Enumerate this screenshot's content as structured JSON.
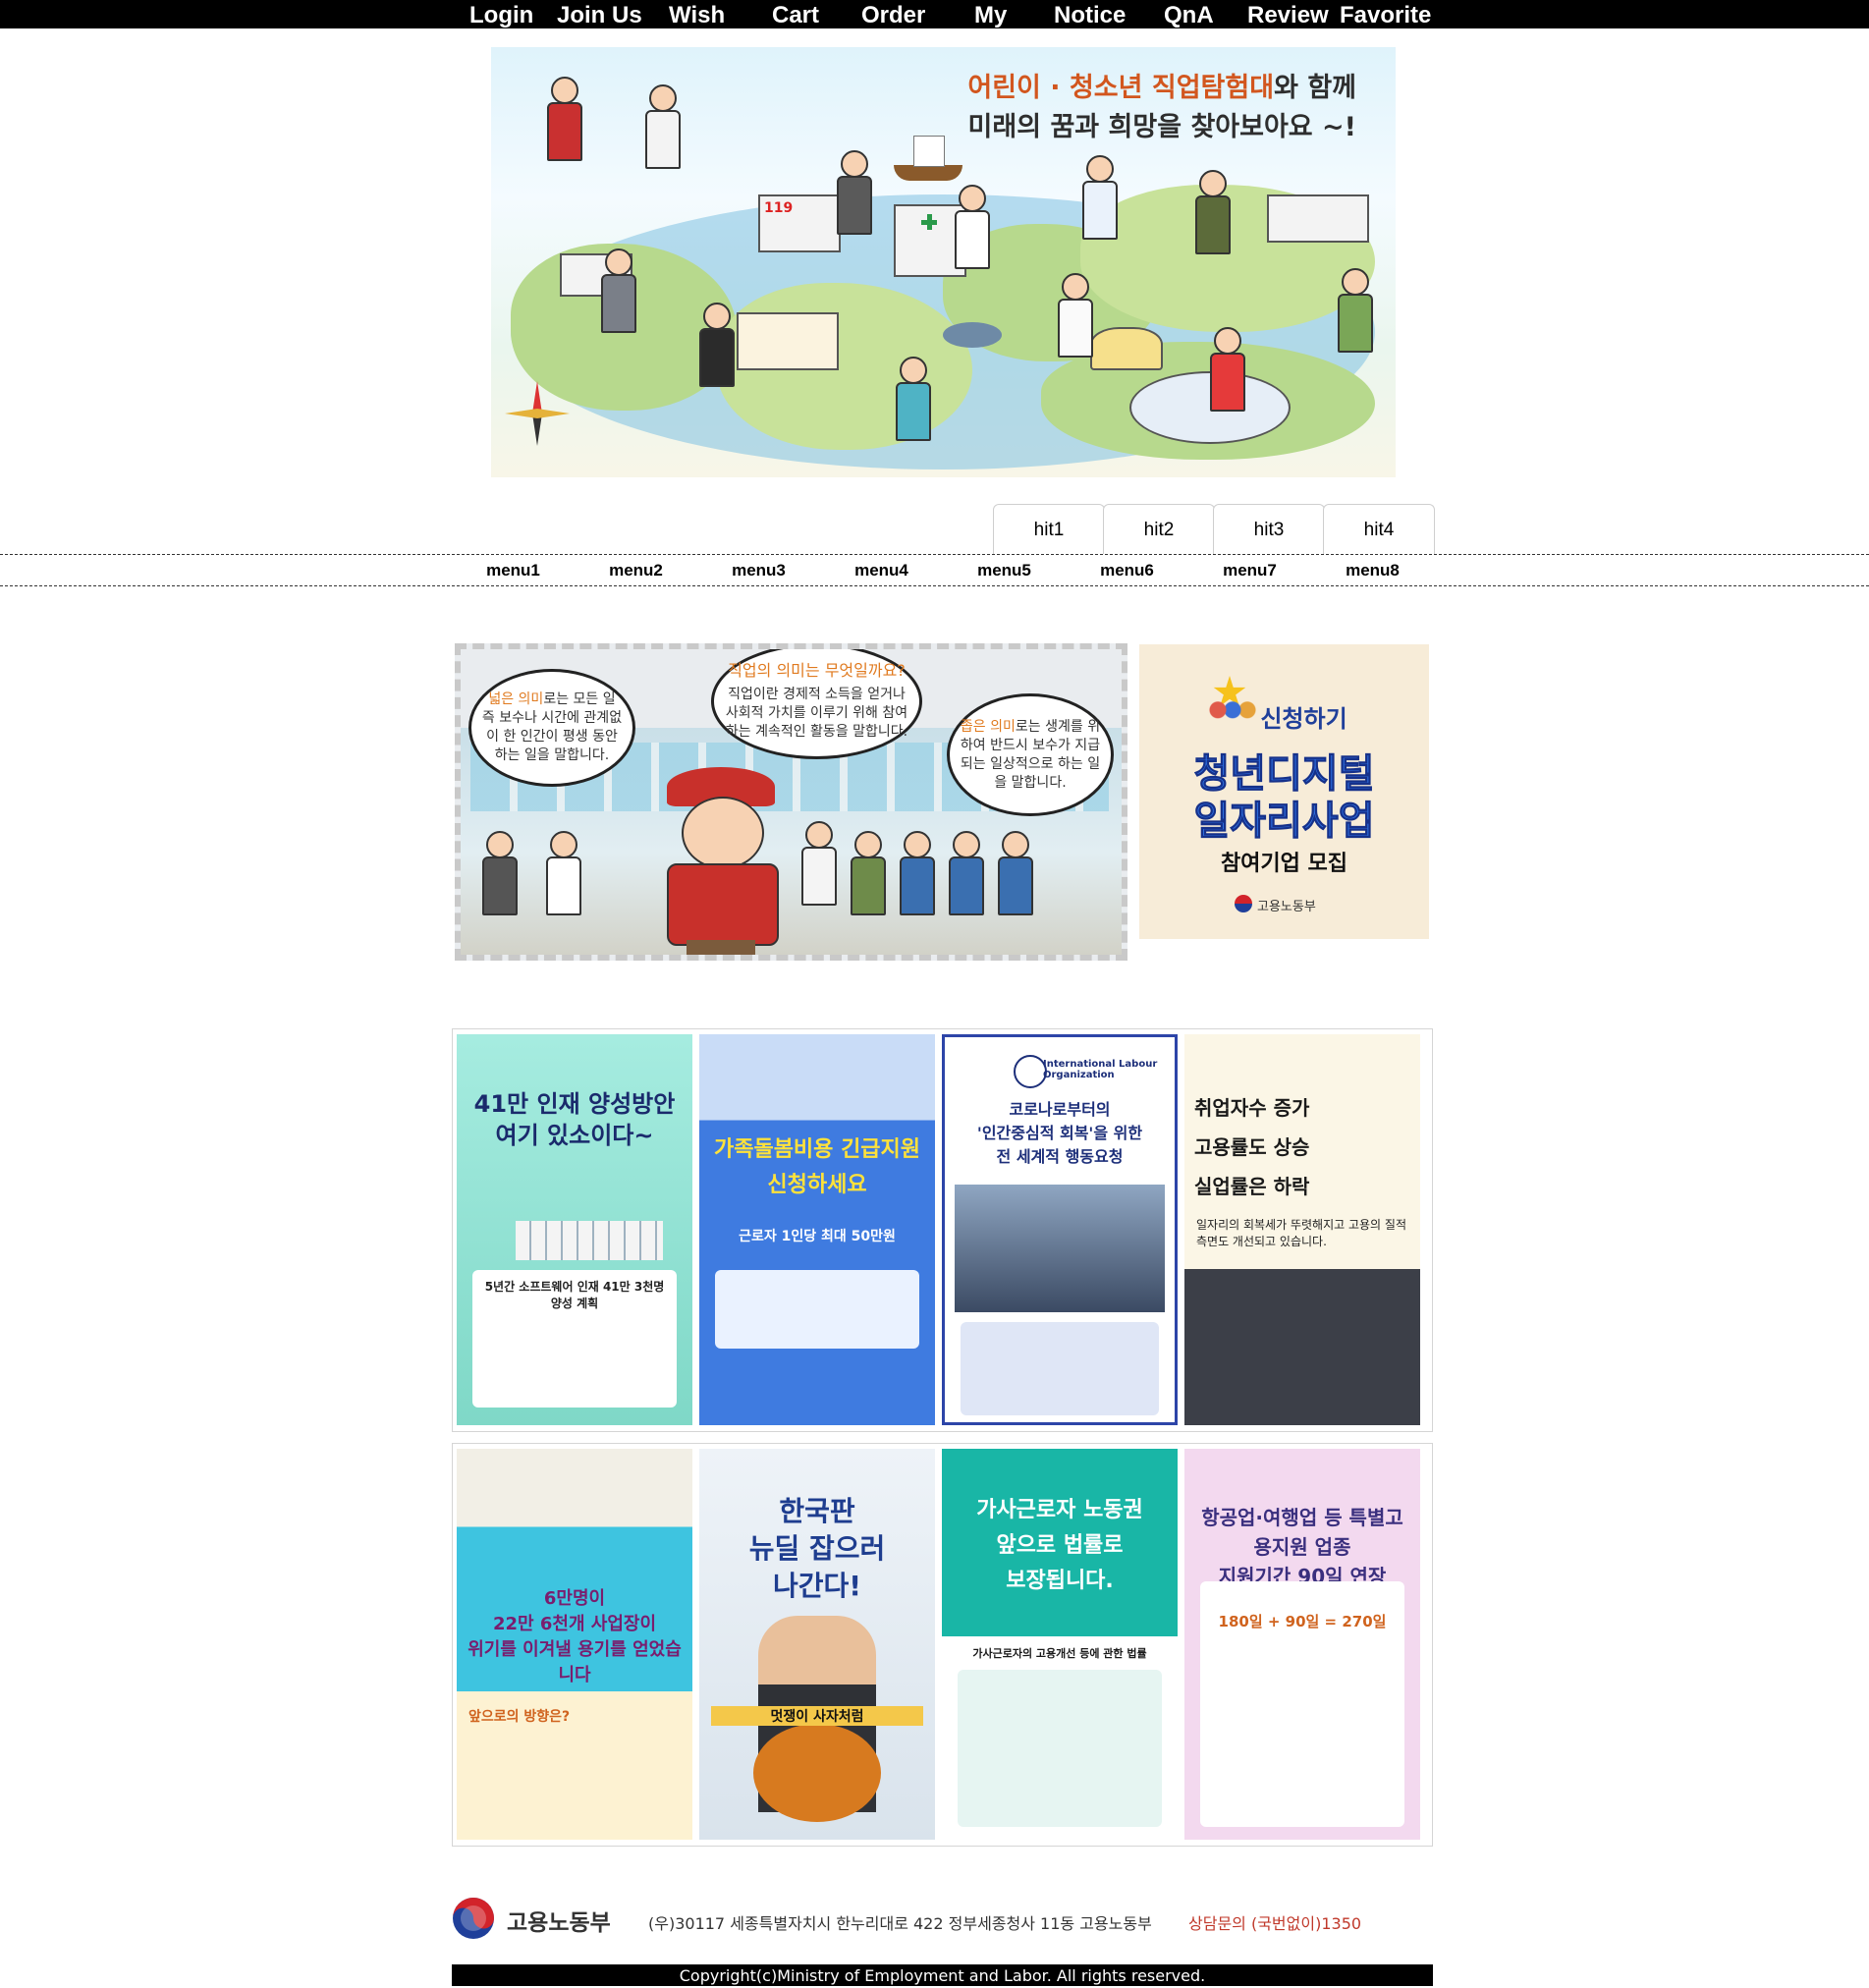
{
  "top_nav": {
    "links": [
      "Login",
      "Join Us",
      "Wish",
      "Cart",
      "Order",
      "My",
      "Notice",
      "QnA",
      "Review",
      "Favorite"
    ]
  },
  "hero": {
    "line1_part1": "어린이 · 청소년 직업탐험대",
    "line1_part2": "와 함께",
    "line2": "미래의 꿈과 희망을 찾아보아요 ~!",
    "sign_119": "119"
  },
  "hit_tabs": [
    "hit1",
    "hit2",
    "hit3",
    "hit4"
  ],
  "menu": [
    "menu1",
    "menu2",
    "menu3",
    "menu4",
    "menu5",
    "menu6",
    "menu7",
    "menu8"
  ],
  "comic": {
    "question": "직업의 의미는 무엇일까요?",
    "definition": "직업이란 경제적 소득을 얻거나 사회적 가치를 이루기 위해 참여하는 계속적인 활동을 말합니다.",
    "broad_highlight": "넓은 의미",
    "broad_text": "로는 모든 일 즉 보수나 시간에 관계없이 한 인간이 평생 동안 하는 일을 말합니다.",
    "narrow_highlight": "좁은 의미",
    "narrow_text": "로는 생계를 위하여 반드시 보수가 지급되는 일상적으로 하는 일을 말합니다."
  },
  "promo": {
    "apply": "신청하기",
    "title_line1": "청년디지털",
    "title_line2": "일자리사업",
    "subtitle": "참여기업 모집",
    "org": "고용노동부"
  },
  "posters_row1": [
    {
      "title": "41만 인재 양성방안\n여기 있소이다~",
      "sub": "5년간 소프트웨어 인재 41만 3천명 양성 계획",
      "bg": "#8fe3d2",
      "fg": "#1a2a6c"
    },
    {
      "title": "가족돌봄비용 긴급지원\n신청하세요",
      "sub": "근로자 1인당 최대 50만원",
      "bg": "#3f7be0",
      "fg": "#ffe23a"
    },
    {
      "title": "코로나로부터의\n'인간중심적 회복'을 위한\n전 세계적 행동요청",
      "sub": "International Labour Organization",
      "bg": "#ffffff",
      "fg": "#1d2f7a"
    },
    {
      "title": "취업자수 증가\n고용률도 상승\n실업률은 하락",
      "sub": "일자리의 회복세가 뚜렷해지고 고용의 질적 측면도 개선되고 있습니다.",
      "bg": "#fbf6e6",
      "fg": "#1a1a1a"
    }
  ],
  "posters_row2": [
    {
      "title": "6만명이\n22만 6천개 사업장이\n위기를 이겨낼 용기를 얻었습니다",
      "sub": "앞으로의 방향은?",
      "bg": "#3ec4e0",
      "fg": "#7a1d6e"
    },
    {
      "title": "한국판\n뉴딜 잡으러\n나간다!",
      "sub": "멋쟁이 사자처럼",
      "bg": "#e8eef4",
      "fg": "#1e3d8f"
    },
    {
      "title": "가사근로자 노동권\n앞으로 법률로\n보장됩니다.",
      "sub": "가사근로자의 고용개선 등에 관한 법률",
      "bg": "#19b6a6",
      "fg": "#ffffff"
    },
    {
      "title": "항공업·여행업 등 특별고용지원 업종\n지원기간 90일 연장",
      "sub": "180일 + 90일 = 270일",
      "bg": "#f3d9ef",
      "fg": "#3a2f7e"
    }
  ],
  "footer": {
    "org": "고용노동부",
    "address": "(우)30117 세종특별자치시 한누리대로 422 정부세종청사 11동 고용노동부",
    "contact": "상담문의 (국번없이)1350",
    "copyright": "Copyright(c)Ministry of Employment and Labor. All rights reserved."
  },
  "colors": {
    "nav_bg": "#000000",
    "accent_orange": "#e07a1f",
    "contact_red": "#c0392b",
    "promo_blue": "#2f6fe0"
  }
}
